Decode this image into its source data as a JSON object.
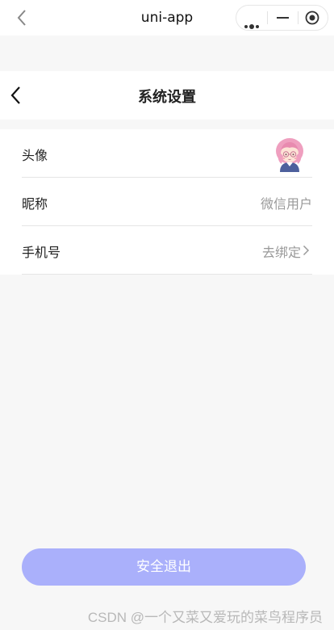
{
  "mp_bar": {
    "title": "uni-app"
  },
  "page": {
    "title": "系统设置"
  },
  "settings": [
    {
      "label": "头像",
      "value": ""
    },
    {
      "label": "昵称",
      "value": "微信用户"
    },
    {
      "label": "手机号",
      "value": "去绑定"
    }
  ],
  "logout_label": "安全退出",
  "watermark": "CSDN @一个又菜又爱玩的菜鸟程序员",
  "colors": {
    "accent": "#aab0fb",
    "muted_text": "#999999",
    "background": "#f7f7f7"
  }
}
